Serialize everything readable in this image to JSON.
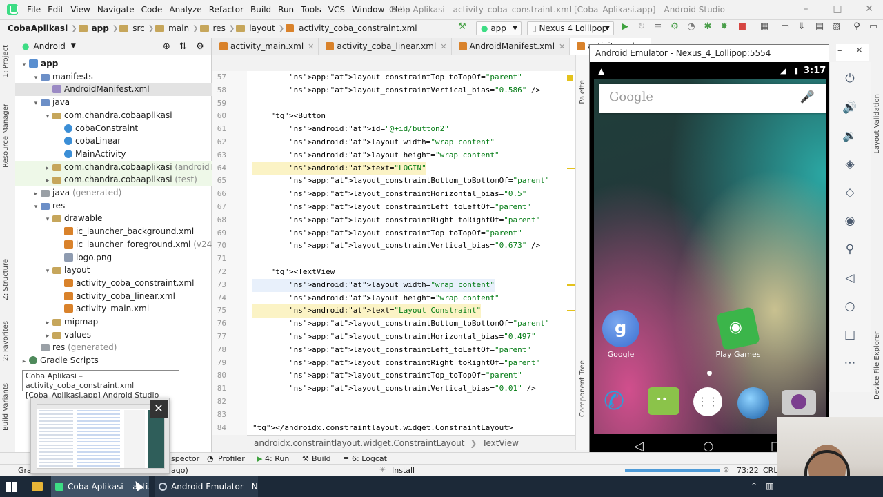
{
  "menu": [
    "File",
    "Edit",
    "View",
    "Navigate",
    "Code",
    "Analyze",
    "Refactor",
    "Build",
    "Run",
    "Tools",
    "VCS",
    "Window",
    "Help"
  ],
  "window_title": "Coba Aplikasi - activity_coba_constraint.xml [Coba_Aplikasi.app] - Android Studio",
  "breadcrumbs": [
    "CobaAplikasi",
    "app",
    "src",
    "main",
    "res",
    "layout",
    "activity_coba_constraint.xml"
  ],
  "toolbar": {
    "module": "app",
    "device": "Nexus 4 Lollipop"
  },
  "left_stripe": [
    "1: Project",
    "Resource Manager",
    "Z: Structure",
    "2: Favorites",
    "Build Variants"
  ],
  "project": {
    "view_mode": "Android",
    "tree": [
      {
        "label": "app",
        "suffix": "",
        "depth": 0,
        "icon": "app",
        "arrow": "▾",
        "bold": true
      },
      {
        "label": "manifests",
        "suffix": "",
        "depth": 1,
        "icon": "folderb",
        "arrow": "▾"
      },
      {
        "label": "AndroidManifest.xml",
        "suffix": "",
        "depth": 2,
        "icon": "mf",
        "arrow": "",
        "sel": true
      },
      {
        "label": "java",
        "suffix": "",
        "depth": 1,
        "icon": "folderb",
        "arrow": "▾"
      },
      {
        "label": "com.chandra.cobaaplikasi",
        "suffix": "",
        "depth": 2,
        "icon": "folder",
        "arrow": "▾"
      },
      {
        "label": "cobaConstraint",
        "suffix": "",
        "depth": 3,
        "icon": "cls",
        "arrow": ""
      },
      {
        "label": "cobaLinear",
        "suffix": "",
        "depth": 3,
        "icon": "cls",
        "arrow": ""
      },
      {
        "label": "MainActivity",
        "suffix": "",
        "depth": 3,
        "icon": "cls",
        "arrow": ""
      },
      {
        "label": "com.chandra.cobaaplikasi",
        "suffix": " (androidTest)",
        "depth": 2,
        "icon": "folder",
        "arrow": "▸",
        "green": true
      },
      {
        "label": "com.chandra.cobaaplikasi",
        "suffix": " (test)",
        "depth": 2,
        "icon": "folder",
        "arrow": "▸",
        "green": true
      },
      {
        "label": "java",
        "suffix": " (generated)",
        "depth": 1,
        "icon": "folderg",
        "arrow": "▸"
      },
      {
        "label": "res",
        "suffix": "",
        "depth": 1,
        "icon": "folderb",
        "arrow": "▾"
      },
      {
        "label": "drawable",
        "suffix": "",
        "depth": 2,
        "icon": "folder",
        "arrow": "▾"
      },
      {
        "label": "ic_launcher_background.xml",
        "suffix": "",
        "depth": 3,
        "icon": "xml",
        "arrow": ""
      },
      {
        "label": "ic_launcher_foreground.xml",
        "suffix": " (v24)",
        "depth": 3,
        "icon": "xml",
        "arrow": ""
      },
      {
        "label": "logo.png",
        "suffix": "",
        "depth": 3,
        "icon": "png",
        "arrow": ""
      },
      {
        "label": "layout",
        "suffix": "",
        "depth": 2,
        "icon": "folder",
        "arrow": "▾"
      },
      {
        "label": "activity_coba_constraint.xml",
        "suffix": "",
        "depth": 3,
        "icon": "xml",
        "arrow": ""
      },
      {
        "label": "activity_coba_linear.xml",
        "suffix": "",
        "depth": 3,
        "icon": "xml",
        "arrow": ""
      },
      {
        "label": "activity_main.xml",
        "suffix": "",
        "depth": 3,
        "icon": "xml",
        "arrow": ""
      },
      {
        "label": "mipmap",
        "suffix": "",
        "depth": 2,
        "icon": "folder",
        "arrow": "▸"
      },
      {
        "label": "values",
        "suffix": "",
        "depth": 2,
        "icon": "folder",
        "arrow": "▸"
      },
      {
        "label": "res",
        "suffix": " (generated)",
        "depth": 1,
        "icon": "folderg",
        "arrow": ""
      },
      {
        "label": "Gradle Scripts",
        "suffix": "",
        "depth": 0,
        "icon": "gradle",
        "arrow": "▸"
      }
    ]
  },
  "tabs": [
    {
      "label": "activity_main.xml",
      "active": false
    },
    {
      "label": "activity_coba_linear.xml",
      "active": false
    },
    {
      "label": "AndroidManifest.xml",
      "active": false
    },
    {
      "label": "activity_coba_",
      "active": true
    }
  ],
  "code": {
    "lines": [
      {
        "n": "57",
        "text": "        app:layout_constraintTop_toTopOf=\"parent\""
      },
      {
        "n": "58",
        "text": "        app:layout_constraintVertical_bias=\"0.586\" />"
      },
      {
        "n": "59",
        "text": ""
      },
      {
        "n": "60",
        "text": "    <Button"
      },
      {
        "n": "61",
        "text": "        android:id=\"@+id/button2\""
      },
      {
        "n": "62",
        "text": "        android:layout_width=\"wrap_content\""
      },
      {
        "n": "63",
        "text": "        android:layout_height=\"wrap_content\""
      },
      {
        "n": "64",
        "text": "        android:text=\"LOGIN\"",
        "hl": true
      },
      {
        "n": "65",
        "text": "        app:layout_constraintBottom_toBottomOf=\"parent\""
      },
      {
        "n": "66",
        "text": "        app:layout_constraintHorizontal_bias=\"0.5\""
      },
      {
        "n": "67",
        "text": "        app:layout_constraintLeft_toLeftOf=\"parent\""
      },
      {
        "n": "68",
        "text": "        app:layout_constraintRight_toRightOf=\"parent\""
      },
      {
        "n": "69",
        "text": "        app:layout_constraintTop_toTopOf=\"parent\""
      },
      {
        "n": "70",
        "text": "        app:layout_constraintVertical_bias=\"0.673\" />"
      },
      {
        "n": "71",
        "text": ""
      },
      {
        "n": "72",
        "text": "    <TextView"
      },
      {
        "n": "73",
        "text": "        android:layout_width=\"wrap_content\"",
        "hl2": true
      },
      {
        "n": "74",
        "text": "        android:layout_height=\"wrap_content\""
      },
      {
        "n": "75",
        "text": "        android:text=\"Layout Constraint\"",
        "hl": true
      },
      {
        "n": "76",
        "text": "        app:layout_constraintBottom_toBottomOf=\"parent\""
      },
      {
        "n": "77",
        "text": "        app:layout_constraintHorizontal_bias=\"0.497\""
      },
      {
        "n": "78",
        "text": "        app:layout_constraintLeft_toLeftOf=\"parent\""
      },
      {
        "n": "79",
        "text": "        app:layout_constraintRight_toRightOf=\"parent\""
      },
      {
        "n": "80",
        "text": "        app:layout_constraintTop_toTopOf=\"parent\""
      },
      {
        "n": "81",
        "text": "        app:layout_constraintVertical_bias=\"0.01\" />"
      },
      {
        "n": "82",
        "text": ""
      },
      {
        "n": "83",
        "text": ""
      },
      {
        "n": "84",
        "text": "</androidx.constraintlayout.widget.ConstraintLayout>"
      }
    ],
    "breadcrumb": [
      "androidx.constraintlayout.widget.ConstraintLayout",
      "TextView"
    ]
  },
  "editor_side": [
    "Palette",
    "Component Tree"
  ],
  "right_stripe": [
    "Layout Validation",
    "Device File Explorer"
  ],
  "emulator": {
    "title": "Android Emulator - Nexus_4_Lollipop:5554",
    "time": "3:17",
    "search_placeholder": "Google",
    "home_apps": [
      {
        "label": "Google",
        "icon": "google-search-icon"
      },
      {
        "label": "Play Games",
        "icon": "play-games-icon"
      }
    ],
    "dock": [
      "phone-icon",
      "messaging-icon",
      "app-drawer-icon",
      "browser-icon",
      "camera-icon"
    ],
    "side_controls": [
      "power-icon",
      "volume-up-icon",
      "volume-down-icon",
      "rotate-left-icon",
      "rotate-right-icon",
      "screenshot-icon",
      "zoom-icon",
      "back-icon",
      "home-icon",
      "overview-icon",
      "more-icon"
    ]
  },
  "tooltip": {
    "line1": "Coba Aplikasi – activity_coba_constraint.xml",
    "line2": "[Coba_Aplikasi.app] Android Studio"
  },
  "bottom_tools": [
    "spector",
    "Profiler",
    "4: Run",
    "Build",
    "6: Logcat"
  ],
  "status": {
    "left_prefix": "Grad",
    "left_suffix": "ago)",
    "install": "Install",
    "position": "73:22",
    "line_sep": "CRL"
  },
  "taskbar": [
    {
      "label": "Coba Aplikasi – acti..."
    },
    {
      "label": "Android Emulator - N..."
    }
  ],
  "colors": {
    "accent": "#3ddc84",
    "taskbar": "#1c2938",
    "selection": "#e3e3e3"
  }
}
